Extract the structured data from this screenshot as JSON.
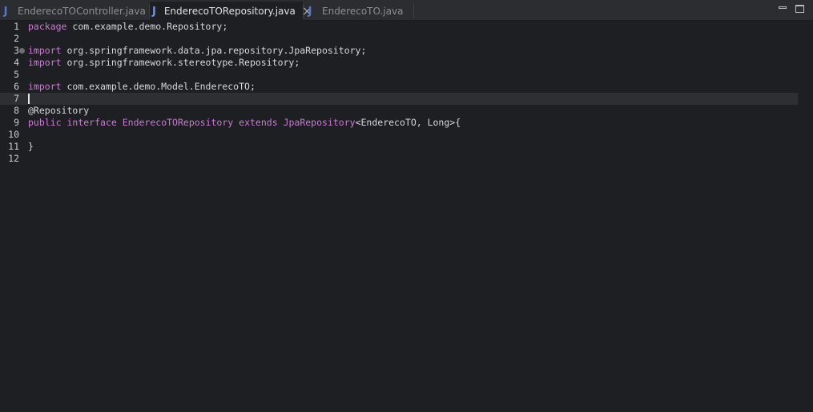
{
  "tabs": [
    {
      "label": "EnderecoTOController.java",
      "active": false,
      "icon": "java-file-icon"
    },
    {
      "label": "EnderecoTORepository.java",
      "active": true,
      "icon": "java-file-icon"
    },
    {
      "label": "EnderecoTO.java",
      "active": false,
      "icon": "java-file-icon"
    }
  ],
  "tab_icon_glyph": "J",
  "window_controls": {
    "minimize": "minimize-icon",
    "maximize": "maximize-icon"
  },
  "editor": {
    "current_line": 7,
    "lines": [
      {
        "n": "1",
        "tokens": [
          {
            "t": "package",
            "c": "kw"
          },
          {
            "t": " com.example.demo.Repository;",
            "c": "plain"
          }
        ]
      },
      {
        "n": "2",
        "tokens": []
      },
      {
        "n": "3",
        "fold": true,
        "tokens": [
          {
            "t": "import",
            "c": "kw"
          },
          {
            "t": " org.springframework.data.jpa.repository.JpaRepository;",
            "c": "plain"
          }
        ]
      },
      {
        "n": "4",
        "tokens": [
          {
            "t": "import",
            "c": "kw"
          },
          {
            "t": " org.springframework.stereotype.Repository;",
            "c": "plain"
          }
        ]
      },
      {
        "n": "5",
        "tokens": []
      },
      {
        "n": "6",
        "tokens": [
          {
            "t": "import",
            "c": "kw"
          },
          {
            "t": " com.example.demo.Model.EnderecoTO;",
            "c": "plain"
          }
        ]
      },
      {
        "n": "7",
        "tokens": []
      },
      {
        "n": "8",
        "tokens": [
          {
            "t": "@Repository",
            "c": "ann"
          }
        ]
      },
      {
        "n": "9",
        "tokens": [
          {
            "t": "public",
            "c": "kw"
          },
          {
            "t": " ",
            "c": "plain"
          },
          {
            "t": "interface",
            "c": "kw"
          },
          {
            "t": " ",
            "c": "plain"
          },
          {
            "t": "EnderecoTORepository",
            "c": "ty"
          },
          {
            "t": " ",
            "c": "plain"
          },
          {
            "t": "extends",
            "c": "kw"
          },
          {
            "t": " ",
            "c": "plain"
          },
          {
            "t": "JpaRepository",
            "c": "ty"
          },
          {
            "t": "<EnderecoTO, Long>{",
            "c": "plain"
          }
        ]
      },
      {
        "n": "10",
        "tokens": []
      },
      {
        "n": "11",
        "tokens": [
          {
            "t": "}",
            "c": "plain"
          }
        ]
      },
      {
        "n": "12",
        "tokens": []
      }
    ]
  },
  "colors": {
    "background": "#1e1f22",
    "tabbar": "#2b2d30",
    "keyword": "#cc7bd6",
    "text": "#d6d8db",
    "line_number": "#c9ccd0",
    "current_line": "#2d2f32",
    "java_icon": "#6f93f0"
  }
}
